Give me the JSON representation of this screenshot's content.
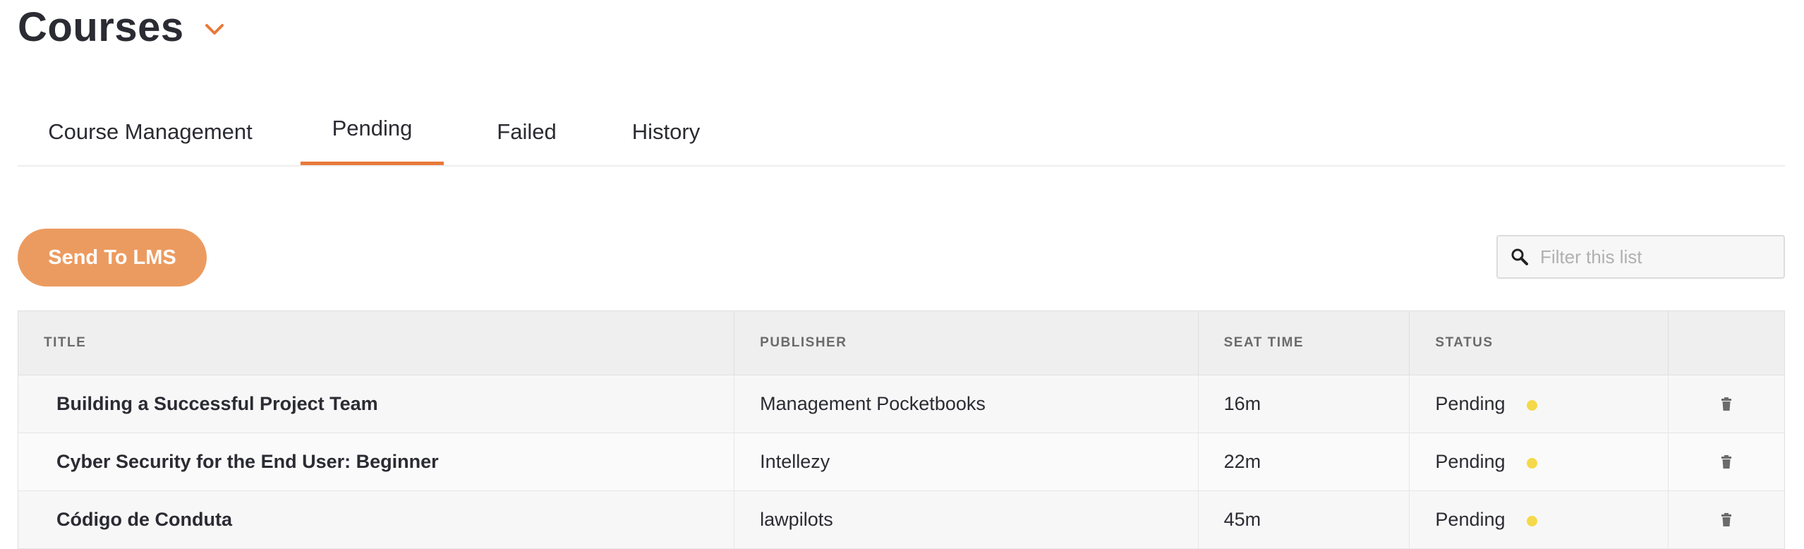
{
  "page": {
    "title": "Courses"
  },
  "tabs": [
    {
      "label": "Course Management"
    },
    {
      "label": "Pending"
    },
    {
      "label": "Failed"
    },
    {
      "label": "History"
    }
  ],
  "toolbar": {
    "send_label": "Send To LMS"
  },
  "filter": {
    "placeholder": "Filter this list",
    "value": ""
  },
  "table": {
    "columns": [
      "TITLE",
      "PUBLISHER",
      "SEAT TIME",
      "STATUS",
      ""
    ],
    "rows": [
      {
        "title": "Building a Successful Project Team",
        "publisher": "Management Pocketbooks",
        "seat_time": "16m",
        "status": "Pending"
      },
      {
        "title": "Cyber Security for the End User: Beginner",
        "publisher": "Intellezy",
        "seat_time": "22m",
        "status": "Pending"
      },
      {
        "title": "Código de Conduta",
        "publisher": "lawpilots",
        "seat_time": "45m",
        "status": "Pending"
      }
    ]
  },
  "colors": {
    "accent": "#e8793a",
    "button": "#ec9b60",
    "status_pending": "#f5d94a"
  },
  "icons": {
    "title_dropdown": "chevron-down-icon",
    "filter": "search-icon",
    "row_action": "trash-icon"
  }
}
